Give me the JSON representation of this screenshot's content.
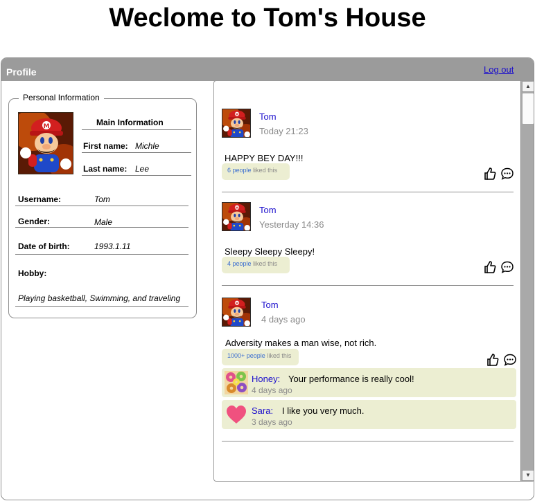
{
  "page": {
    "title": "Weclome to Tom's House"
  },
  "window": {
    "title": "Profile",
    "logout_label": "Log out"
  },
  "personal": {
    "legend": "Personal Information",
    "main_info_heading": "Main Information",
    "first_name_label": "First name:",
    "first_name_value": "Michle",
    "last_name_label": "Last name:",
    "last_name_value": "Lee",
    "username_label": "Username:",
    "username_value": "Tom",
    "gender_label": "Gender:",
    "gender_value": "Male",
    "dob_label": "Date of birth:",
    "dob_value": "1993.1.11",
    "hobby_label": "Hobby:",
    "hobby_value": "Playing basketball, Swimming, and traveling"
  },
  "feed": {
    "liked_suffix": "liked this",
    "posts": [
      {
        "author": "Tom",
        "time": "Today 21:23",
        "text": "HAPPY BEY DAY!!!",
        "likes": "6 people"
      },
      {
        "author": "Tom",
        "time": "Yesterday 14:36",
        "text": "Sleepy Sleepy Sleepy!",
        "likes": "4 people"
      },
      {
        "author": "Tom",
        "time": "4 days ago",
        "text": "Adversity makes a man wise, not rich.",
        "likes": "1000+ people",
        "comments": [
          {
            "name": "Honey:",
            "text": "Your performance is really cool!",
            "time": "4 days ago"
          },
          {
            "name": "Sara:",
            "text": "I like you very much.",
            "time": "3 days ago"
          }
        ]
      }
    ]
  },
  "colors": {
    "titlebar": "#9b9b9b",
    "link": "#1a0dcc",
    "like_bar": "#eceed2",
    "like_count": "#3b6ed0",
    "heart": "#f0517f"
  },
  "icons": [
    "thumbs-up-icon",
    "comment-icon",
    "heart-icon",
    "scroll-up-arrow-icon",
    "scroll-down-arrow-icon"
  ]
}
